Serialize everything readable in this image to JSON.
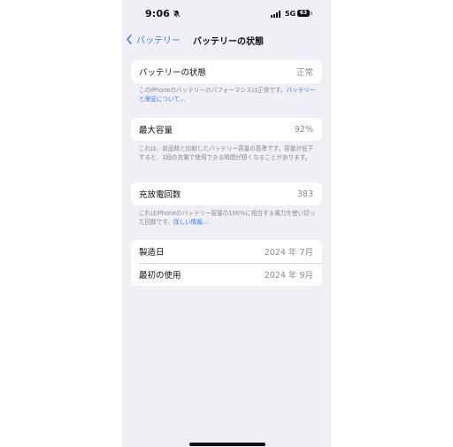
{
  "status_bar": {
    "time": "9:06",
    "network": "5G",
    "battery_level": "63"
  },
  "nav": {
    "back_label": "バッテリー",
    "title": "バッテリーの状態"
  },
  "battery_health": {
    "label": "バッテリーの状態",
    "value": "正常",
    "footer_text": "このiPhoneのバッテリーのパフォーマンスは正常です。",
    "footer_link": "バッテリーと保証について..."
  },
  "max_capacity": {
    "label": "最大容量",
    "value": "92%",
    "footer_text": "これは、新品時と比較したバッテリー容量の基準です。容量が低下すると、1回の充電で使用できる時間が短くなることがあります。"
  },
  "cycle_count": {
    "label": "充放電回数",
    "value": "383",
    "footer_text": "これはiPhoneのバッテリー容量の100%に相当する電力を使い切った回数です。",
    "footer_link": "詳しい情報..."
  },
  "dates": {
    "manufacture_label": "製造日",
    "manufacture_value": "2024 年 7月",
    "first_use_label": "最初の使用",
    "first_use_value": "2024 年 9月"
  },
  "icons": {
    "bell": "bell-slash-icon",
    "signal": "signal-bars-icon",
    "battery": "battery-icon",
    "back": "chevron-left-icon"
  },
  "colors": {
    "accent": "#2f7bf6",
    "background": "#f0eff6",
    "card": "#ffffff",
    "secondary_text": "#8a8a8e"
  }
}
